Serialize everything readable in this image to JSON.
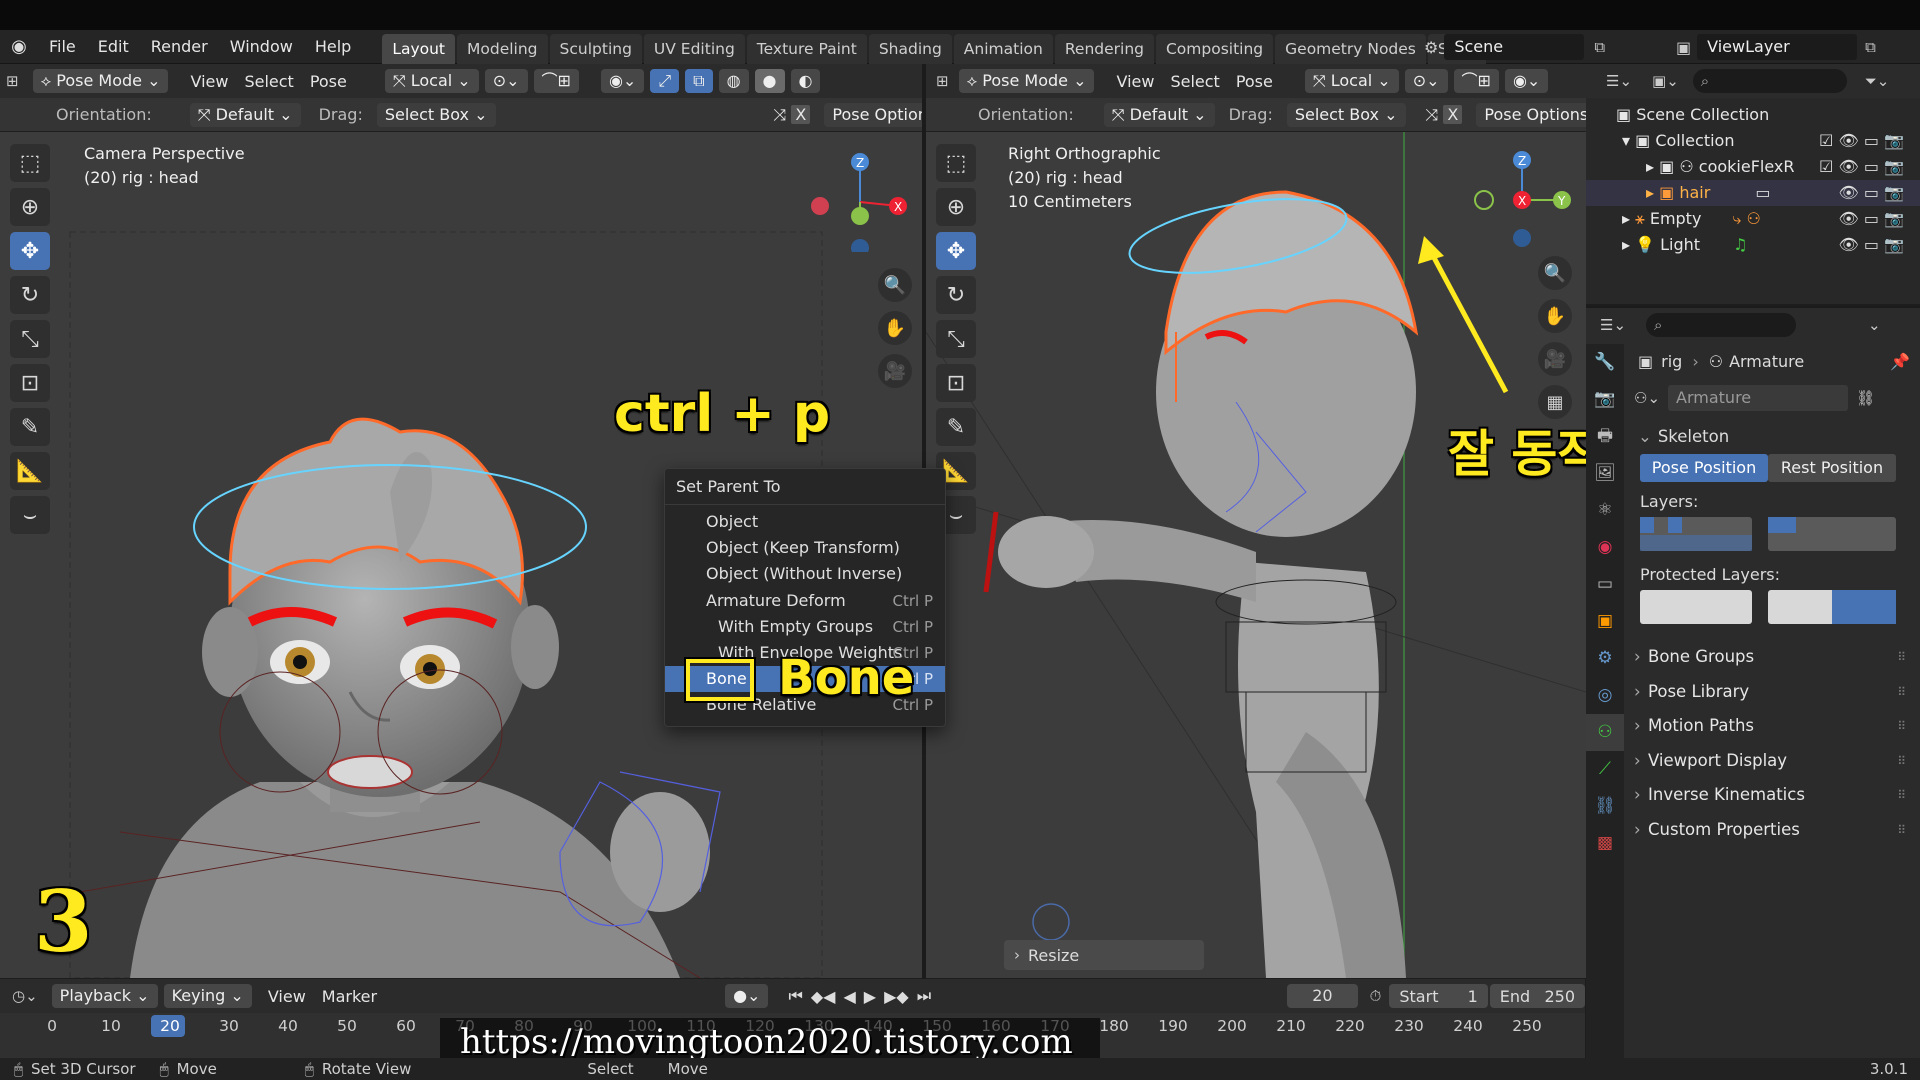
{
  "menus": [
    "File",
    "Edit",
    "Render",
    "Window",
    "Help"
  ],
  "workspaces": [
    "Layout",
    "Modeling",
    "Sculpting",
    "UV Editing",
    "Texture Paint",
    "Shading",
    "Animation",
    "Rendering",
    "Compositing",
    "Geometry Nodes",
    "Scriptin"
  ],
  "active_workspace": "Layout",
  "scene": "Scene",
  "view_layer": "ViewLayer",
  "left_viewport": {
    "mode": "Pose Mode",
    "menus": [
      "View",
      "Select",
      "Pose"
    ],
    "transform": "Local",
    "orientation_label": "Orientation:",
    "orientation": "Default",
    "drag_label": "Drag:",
    "drag": "Select Box",
    "pose_options": "Pose Options",
    "line1": "Camera Perspective",
    "line2": "(20) rig : head"
  },
  "right_viewport": {
    "mode": "Pose Mode",
    "menus": [
      "View",
      "Select",
      "Pose"
    ],
    "transform": "Local",
    "orientation_label": "Orientation:",
    "orientation": "Default",
    "drag_label": "Drag:",
    "drag": "Select Box",
    "pose_options": "Pose Options",
    "line1": "Right Orthographic",
    "line2": "(20) rig : head",
    "line3": "10 Centimeters",
    "resize_panel": "Resize"
  },
  "context_menu": {
    "title": "Set Parent To",
    "items": [
      {
        "label": "Object",
        "shortcut": ""
      },
      {
        "label": "Object (Keep Transform)",
        "shortcut": ""
      },
      {
        "label": "Object (Without Inverse)",
        "shortcut": ""
      },
      {
        "label": "Armature Deform",
        "shortcut": "Ctrl P"
      },
      {
        "label": "With Empty Groups",
        "shortcut": "Ctrl P"
      },
      {
        "label": "With Envelope Weights",
        "shortcut": "Ctrl P"
      },
      {
        "label": "Bone",
        "shortcut": "Ctrl P"
      },
      {
        "label": "Bone Relative",
        "shortcut": "Ctrl P"
      }
    ]
  },
  "annotations": {
    "shortcut": "ctrl + p",
    "bone": "Bone",
    "korean": "잘 동작함",
    "step": "3",
    "url": "https://movingtoon2020.tistory.com"
  },
  "outliner": {
    "root": "Scene Collection",
    "rows": [
      {
        "label": "Collection"
      },
      {
        "label": "cookieFlexR"
      },
      {
        "label": "hair"
      },
      {
        "label": "Empty"
      },
      {
        "label": "Light"
      }
    ]
  },
  "properties": {
    "breadcrumb_object": "rig",
    "breadcrumb_data": "Armature",
    "data_name": "Armature",
    "skeleton_label": "Skeleton",
    "pose_position": "Pose Position",
    "rest_position": "Rest Position",
    "layers_label": "Layers:",
    "protected_layers_label": "Protected Layers:",
    "sections": [
      "Bone Groups",
      "Pose Library",
      "Motion Paths",
      "Viewport Display",
      "Inverse Kinematics",
      "Custom Properties"
    ]
  },
  "timeline": {
    "menus": [
      "Playback",
      "Keying",
      "View",
      "Marker"
    ],
    "current_frame": "20",
    "start_label": "Start",
    "start": "1",
    "end_label": "End",
    "end": "250",
    "ticks": [
      "0",
      "10",
      "20",
      "30",
      "40",
      "50",
      "60",
      "70",
      "80",
      "90",
      "100",
      "110",
      "120",
      "130",
      "140",
      "150",
      "160",
      "170",
      "180",
      "190",
      "200",
      "210",
      "220",
      "230",
      "240",
      "250"
    ]
  },
  "statusbar": {
    "items": [
      "Set 3D Cursor",
      "Move",
      "Rotate View",
      "Select",
      "Move"
    ],
    "version": "3.0.1"
  },
  "colors": {
    "accent": "#4772b3",
    "annotation": "#ffea1f",
    "selection_orange": "#ff6a2a"
  }
}
